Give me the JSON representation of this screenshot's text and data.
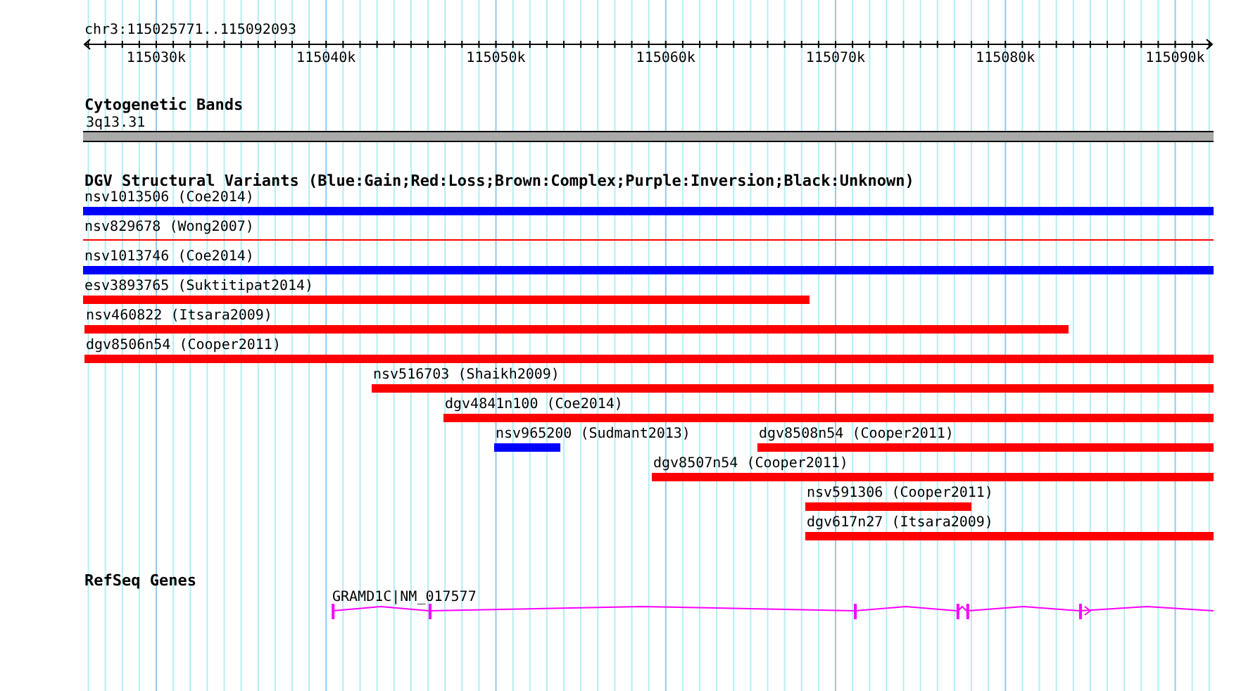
{
  "ruler": {
    "label": "chr3:115025771..115092093",
    "ticks": [
      {
        "label": "115030k"
      },
      {
        "label": "115040k"
      },
      {
        "label": "115050k"
      },
      {
        "label": "115060k"
      },
      {
        "label": "115070k"
      },
      {
        "label": "115080k"
      },
      {
        "label": "115090k"
      }
    ]
  },
  "tracks": [
    {
      "kind": "cytoband",
      "title": "Cytogenetic Bands",
      "bands": [
        {
          "name": "3q13.31"
        }
      ]
    },
    {
      "kind": "variants",
      "title": "DGV Structural Variants (Blue:Gain;Red:Loss;Brown:Complex;Purple:Inversion;Black:Unknown)",
      "rows": [
        [
          {
            "name": "nsv1013506 (Coe2014)",
            "color": "#0000ff",
            "kind": "thick"
          }
        ],
        [
          {
            "name": "nsv829678 (Wong2007)",
            "color": "#ff0000",
            "kind": "thin"
          }
        ],
        [
          {
            "name": "nsv1013746 (Coe2014)",
            "color": "#0000ff",
            "kind": "thick"
          }
        ],
        [
          {
            "name": "esv3893765 (Suktitipat2014)",
            "color": "#ff0000",
            "kind": "thick"
          }
        ],
        [
          {
            "name": "nsv460822 (Itsara2009)",
            "color": "#ff0000",
            "kind": "thick"
          }
        ],
        [
          {
            "name": "dgv8506n54 (Cooper2011)",
            "color": "#ff0000",
            "kind": "thick"
          }
        ],
        [
          {
            "name": "nsv516703 (Shaikh2009)",
            "color": "#ff0000",
            "kind": "thick"
          }
        ],
        [
          {
            "name": "dgv4841n100 (Coe2014)",
            "color": "#ff0000",
            "kind": "thick"
          }
        ],
        [
          {
            "name": "nsv965200 (Sudmant2013)",
            "color": "#0000ff",
            "kind": "thick"
          },
          {
            "name": "dgv8508n54 (Cooper2011)",
            "color": "#ff0000",
            "kind": "thick"
          }
        ],
        [
          {
            "name": "dgv8507n54 (Cooper2011)",
            "color": "#ff0000",
            "kind": "thick"
          }
        ],
        [
          {
            "name": "nsv591306 (Cooper2011)",
            "color": "#ff0000",
            "kind": "thick"
          }
        ],
        [
          {
            "name": "dgv617n27 (Itsara2009)",
            "color": "#ff0000",
            "kind": "thick"
          }
        ]
      ]
    },
    {
      "kind": "genes",
      "title": "RefSeq Genes",
      "genes": [
        {
          "name": "GRAMD1C|NM_017577"
        }
      ]
    }
  ]
}
